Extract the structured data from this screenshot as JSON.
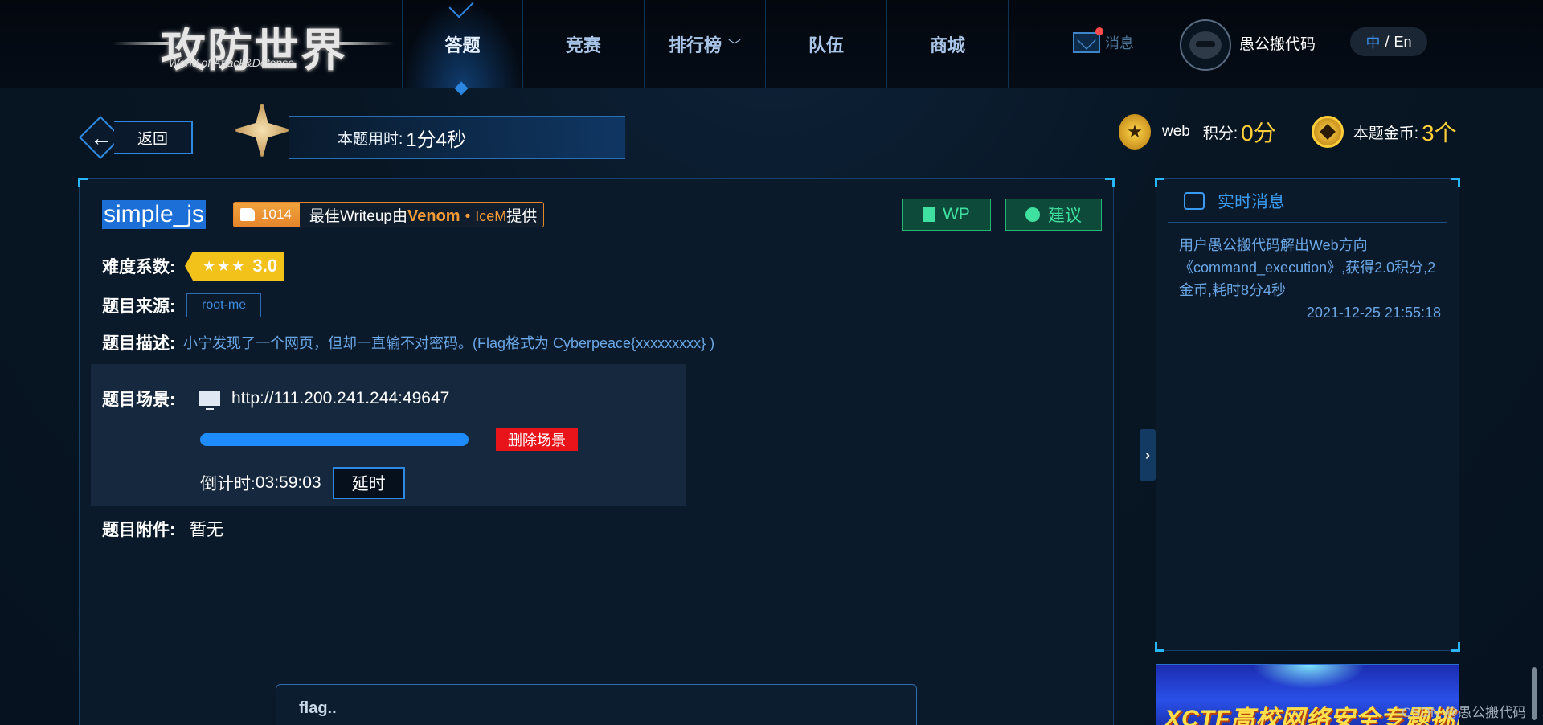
{
  "brand": {
    "logo_main": "攻防世界",
    "logo_sub": "World of Attack&Defense"
  },
  "nav": {
    "items": [
      {
        "label": "答题"
      },
      {
        "label": "竞赛"
      },
      {
        "label": "排行榜"
      },
      {
        "label": "队伍"
      },
      {
        "label": "商城"
      }
    ],
    "active_index": 0,
    "messages_label": "消息",
    "username": "愚公搬代码",
    "lang_zh": "中",
    "lang_sep": "/",
    "lang_en": "En"
  },
  "infobar": {
    "back_label": "返回",
    "time_label": "本题用时:",
    "time_value": "1分4秒",
    "category": "web",
    "score_label": "积分:",
    "score_value": "0分",
    "coin_label": "本题金币:",
    "coin_value": "3个"
  },
  "challenge": {
    "title": "simple_js",
    "likes": "1014",
    "wu_prefix": "最佳Writeup由",
    "wu_author1": "Venom",
    "wu_dot": "•",
    "wu_author2": "IceM",
    "wu_suffix": "提供",
    "wp_label": "WP",
    "suggest_label": "建议",
    "difficulty_label": "难度系数:",
    "difficulty_stars": 3,
    "difficulty_value": "3.0",
    "source_label": "题目来源:",
    "source_value": "root-me",
    "desc_label": "题目描述:",
    "desc_value": "小宁发现了一个网页，但却一直输不对密码。(Flag格式为 Cyberpeace{xxxxxxxxx} )",
    "scene_label": "题目场景:",
    "scene_url": "http://111.200.241.244:49647",
    "scene_progress": 1.0,
    "delete_scene_label": "删除场景",
    "countdown_label": "倒计时:",
    "countdown_value": "03:59:03",
    "extend_label": "延时",
    "attachment_label": "题目附件:",
    "attachment_value": "暂无",
    "flag_placeholder": "flag.."
  },
  "realtime": {
    "title": "实时消息",
    "message": "用户愚公搬代码解出Web方向《command_execution》,获得2.0积分,2金币,耗时8分4秒",
    "timestamp": "2021-12-25 21:55:18"
  },
  "banner": {
    "text": "XCTF高校网络安全专题挑战赛"
  },
  "watermark": "CSDN @愚公搬代码",
  "colors": {
    "accent_blue": "#1e8bff",
    "gold": "#ffcf3a",
    "orange": "#f59a36",
    "green": "#3fe0a0",
    "danger": "#e8141a"
  }
}
